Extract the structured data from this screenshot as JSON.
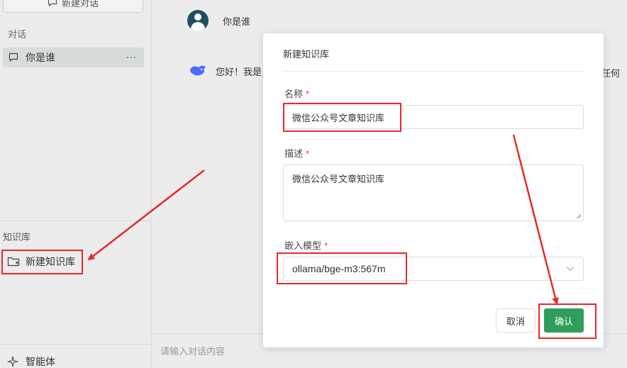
{
  "sidebar": {
    "new_chat_label": "新建对话",
    "conversations_heading": "对话",
    "conversations": [
      {
        "label": "你是谁",
        "more": "···"
      }
    ],
    "knowledge_heading": "知识库",
    "new_knowledge_label": "新建知识库",
    "agent_label": "智能体"
  },
  "chat": {
    "user_message": "你是谁",
    "bot_message_visible_start": "您好！我是",
    "bot_message_visible_end": "任何",
    "input_placeholder": "请输入对话内容"
  },
  "modal": {
    "title": "新建知识库",
    "name_label": "名称",
    "name_value": "微信公众号文章知识库",
    "desc_label": "描述",
    "desc_value": "微信公众号文章知识库",
    "model_label": "嵌入模型",
    "model_value": "ollama/bge-m3:567m",
    "required_mark": "*",
    "cancel_label": "取消",
    "confirm_label": "确认"
  },
  "colors": {
    "accent": "#2e9e5a",
    "annotation": "#e52b2b",
    "required": "#e0443c"
  }
}
